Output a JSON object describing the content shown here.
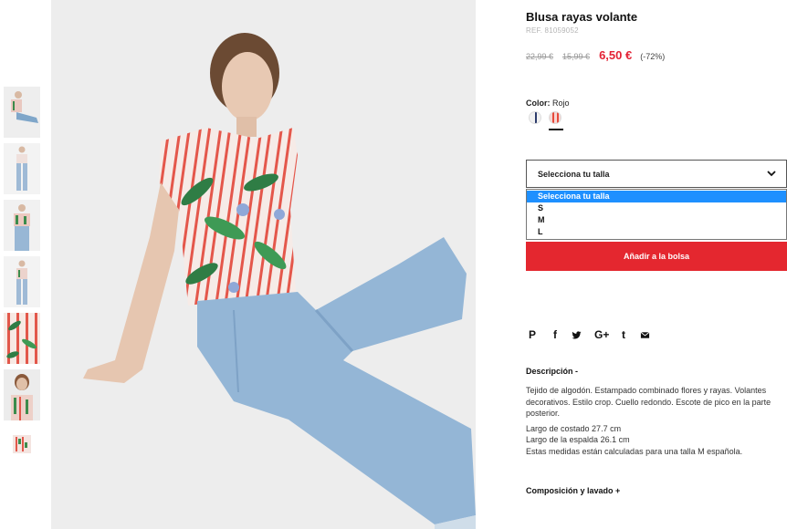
{
  "product": {
    "title": "Blusa rayas volante",
    "ref": "REF. 81059052",
    "price_old_1": "22,99 €",
    "price_old_2": "15,99 €",
    "price_now": "6,50 €",
    "discount": "(-72%)"
  },
  "color": {
    "label": "Color:",
    "value": "Rojo",
    "swatches": [
      "white-navy",
      "red-stripes"
    ],
    "selected": "red-stripes"
  },
  "size": {
    "placeholder": "Selecciona tu talla",
    "options": [
      "Selecciona tu talla",
      "S",
      "M",
      "L"
    ],
    "highlighted": "Selecciona tu talla"
  },
  "cart": {
    "add_label": "Añadir a la bolsa"
  },
  "share_icons": [
    "pinterest-icon",
    "facebook-icon",
    "twitter-icon",
    "google-plus-icon",
    "tumblr-icon",
    "email-icon"
  ],
  "share": {
    "pinterest": "P",
    "facebook": "f",
    "gplus": "G+",
    "tumblr": "t"
  },
  "description": {
    "title": "Descripción -",
    "p1": "Tejido de algodón. Estampado combinado flores y rayas. Volantes decorativos. Estilo crop. Cuello redondo. Escote de pico en la parte posterior.",
    "m1": "Largo de costado 27.7 cm",
    "m2": "Largo de la espalda 26.1 cm",
    "m3": "Estas medidas están calculadas para una talla M española."
  },
  "composition": {
    "title": "Composición y lavado +"
  },
  "colors": {
    "accent": "#e4272f",
    "price": "#e32235",
    "dropdown_highlight": "#1e90ff"
  }
}
